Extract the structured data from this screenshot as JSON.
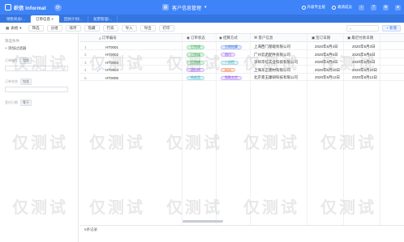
{
  "app": {
    "logo_text": "织信 Informat",
    "title": "客户信息管理"
  },
  "top_right": {
    "upgrade": "升级专业版",
    "invite": "邀请成员"
  },
  "tabs": [
    {
      "label": "销售机会/..."
    },
    {
      "label": "订单信息 ×"
    },
    {
      "label": "回款计划/..."
    },
    {
      "label": "发票管理/..."
    }
  ],
  "toolbar": {
    "view": "表格",
    "a": "筛选",
    "b": "分组",
    "c": "排序",
    "d": "隐藏",
    "e": "行高",
    "f": "导入",
    "g": "导出",
    "h": "打印",
    "add": "+ 新增"
  },
  "filter": {
    "title": "筛选条件",
    "add": "+ 添加过滤器",
    "rows": [
      {
        "label": "订单编号",
        "op": "包含"
      },
      {
        "label": "订单状态",
        "op": "包含"
      },
      {
        "label": "签约日期",
        "op": "等于"
      }
    ]
  },
  "table": {
    "headers": [
      "订单编号",
      "订单状态",
      "结算方式",
      "客户信息",
      "签订日期",
      "最迟付款日期"
    ],
    "rows": [
      {
        "num": "1",
        "id": "HT0001",
        "status": "已完成",
        "status_color": "green",
        "pay": "分期结算",
        "pay_color": "blue",
        "customer": "上海西门基础有限公司",
        "sign": "2020年8月4日",
        "due": "2020年9月3日"
      },
      {
        "num": "2",
        "id": "HT0002",
        "status": "已完成",
        "status_color": "green",
        "pay": "首付",
        "pay_color": "purple",
        "customer": "广州云诺配件有限公司",
        "sign": "2020年8月5日",
        "due": "2020年9月5日"
      },
      {
        "num": "3",
        "id": "HT0003",
        "status": "已完成",
        "status_color": "green",
        "pay": "一次性",
        "pay_color": "teal",
        "customer": "深圳华信实业科技有限公司",
        "sign": "2020年8月6日",
        "due": "2020年9月6日"
      },
      {
        "num": "4",
        "id": "HT0004",
        "status": "进行中",
        "status_color": "purple",
        "pay": "50%",
        "pay_color": "orange",
        "customer": "上海东正建材有限公司",
        "sign": "2020年8月10日",
        "due": "2020年8月10日"
      },
      {
        "num": "5",
        "id": "HT0005",
        "status": "待发货",
        "status_color": "teal",
        "pay": "到款交货",
        "pay_color": "purple",
        "customer": "北京景玉康研科技有限公司",
        "sign": "2020年8月12日",
        "due": "2020年8月12日"
      }
    ]
  },
  "footer": {
    "count": "5条记录"
  },
  "watermark": "仅测试"
}
